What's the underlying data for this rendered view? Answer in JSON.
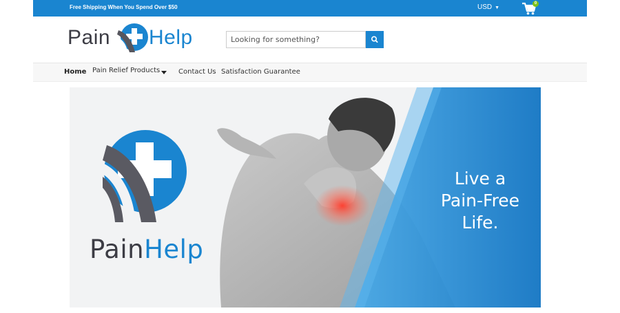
{
  "topbar": {
    "shipping_text": "Free Shipping When You Spend Over $50",
    "currency": "USD",
    "cart_count": "0"
  },
  "header": {
    "logo_part1": "Pain",
    "logo_part2": "Help"
  },
  "search": {
    "placeholder": "Looking for something?",
    "value": ""
  },
  "nav": {
    "items": [
      {
        "label": "Home"
      },
      {
        "label": "Pain Relief Products"
      },
      {
        "label": "Contact Us"
      },
      {
        "label": "Satisfaction Guarantee"
      }
    ]
  },
  "hero": {
    "tagline_lines": [
      "Live a",
      "Pain-Free",
      "Life."
    ],
    "brand_part1": "Pain",
    "brand_part2": "Help"
  },
  "colors": {
    "brand_blue": "#1a85d0",
    "brand_dark": "#3c3c44",
    "cart_badge": "#7ec21a"
  },
  "icons": [
    "cart-icon",
    "search-icon",
    "chevron-down-icon",
    "caret-down-icon"
  ]
}
